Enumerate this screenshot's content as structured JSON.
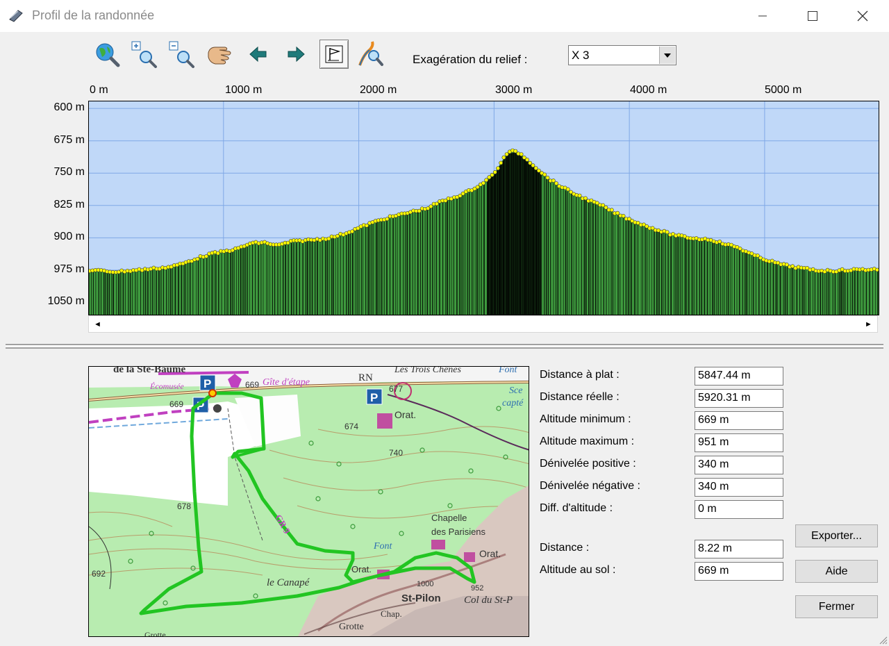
{
  "window": {
    "title": "Profil de la randonnée"
  },
  "toolbar": {
    "exaggeration_label": "Exagération du relief :",
    "exaggeration_value": "X 3",
    "icons": [
      "globe-zoom-icon",
      "zoom-in-icon",
      "zoom-out-icon",
      "pan-hand-icon",
      "previous-arrow-icon",
      "next-arrow-icon",
      "flag-icon",
      "route-zoom-icon"
    ]
  },
  "profile": {
    "x_ticks": [
      "0 m",
      "1000 m",
      "2000 m",
      "3000 m",
      "4000 m",
      "5000 m"
    ],
    "y_ticks": [
      "1050 m",
      "975 m",
      "900 m",
      "825 m",
      "750 m",
      "675 m",
      "600 m"
    ],
    "colors": {
      "sky": "#c0d8f8",
      "fill": "#3e9a3e",
      "points": "#ffff00",
      "grid": "#7fa8e6"
    }
  },
  "chart_data": {
    "type": "area",
    "xlabel": "",
    "ylabel": "",
    "xlim": [
      0,
      5847.44
    ],
    "ylim": [
      570,
      1068
    ],
    "x_ticks": [
      0,
      1000,
      2000,
      3000,
      4000,
      5000
    ],
    "y_ticks": [
      600,
      675,
      750,
      825,
      900,
      975,
      1050
    ],
    "x": [
      0,
      200,
      400,
      600,
      700,
      800,
      900,
      1000,
      1100,
      1200,
      1300,
      1400,
      1500,
      1600,
      1700,
      1800,
      1900,
      2000,
      2100,
      2200,
      2300,
      2400,
      2500,
      2600,
      2700,
      2800,
      2900,
      3000,
      3050,
      3100,
      3150,
      3200,
      3300,
      3400,
      3500,
      3600,
      3700,
      3800,
      3900,
      4000,
      4100,
      4200,
      4300,
      4400,
      4500,
      4600,
      4700,
      4800,
      4900,
      5000,
      5100,
      5200,
      5300,
      5400,
      5500,
      5600,
      5700,
      5847
    ],
    "y": [
      675,
      671,
      676,
      682,
      690,
      702,
      712,
      718,
      724,
      737,
      739,
      732,
      741,
      744,
      746,
      751,
      760,
      773,
      785,
      795,
      803,
      811,
      818,
      833,
      843,
      856,
      873,
      898,
      924,
      948,
      951,
      944,
      916,
      888,
      868,
      851,
      837,
      824,
      807,
      793,
      780,
      769,
      759,
      752,
      748,
      746,
      736,
      728,
      712,
      700,
      690,
      683,
      678,
      674,
      673,
      675,
      676,
      677
    ]
  },
  "nav": {
    "scroll_left": "◄",
    "scroll_right": "►"
  },
  "stats": [
    {
      "label": "Distance à plat :",
      "value": "5847.44 m"
    },
    {
      "label": "Distance réelle :",
      "value": "5920.31 m"
    },
    {
      "label": "Altitude minimum :",
      "value": "669 m"
    },
    {
      "label": "Altitude maximum :",
      "value": "951 m"
    },
    {
      "label": "Dénivelée positive :",
      "value": "340 m"
    },
    {
      "label": "Dénivelée négative :",
      "value": "340 m"
    },
    {
      "label": "Diff. d'altitude :",
      "value": "0 m"
    },
    {
      "label": "Distance :",
      "value": "8.22 m"
    },
    {
      "label": "Altitude au sol :",
      "value": "669 m"
    }
  ],
  "buttons": {
    "export": "Exporter...",
    "help": "Aide",
    "close": "Fermer"
  },
  "map": {
    "labels": [
      "de la Ste-Baume",
      "Écomusée",
      "Gîte d'étape",
      "RN",
      "Les Trois Chênes",
      "Font",
      "Sce",
      "capté",
      "669",
      "669",
      "677",
      "674",
      "Orat.",
      "740",
      "678",
      "GR 9",
      "Chapelle",
      "des Parisiens",
      "Font",
      "Orat.",
      "692",
      "le Canapé",
      "Orat.",
      "1000",
      "952",
      "St-Pilon",
      "Col du St-P",
      "Chap.",
      "Grotte",
      "Grotte",
      "P",
      "P",
      "P"
    ]
  }
}
